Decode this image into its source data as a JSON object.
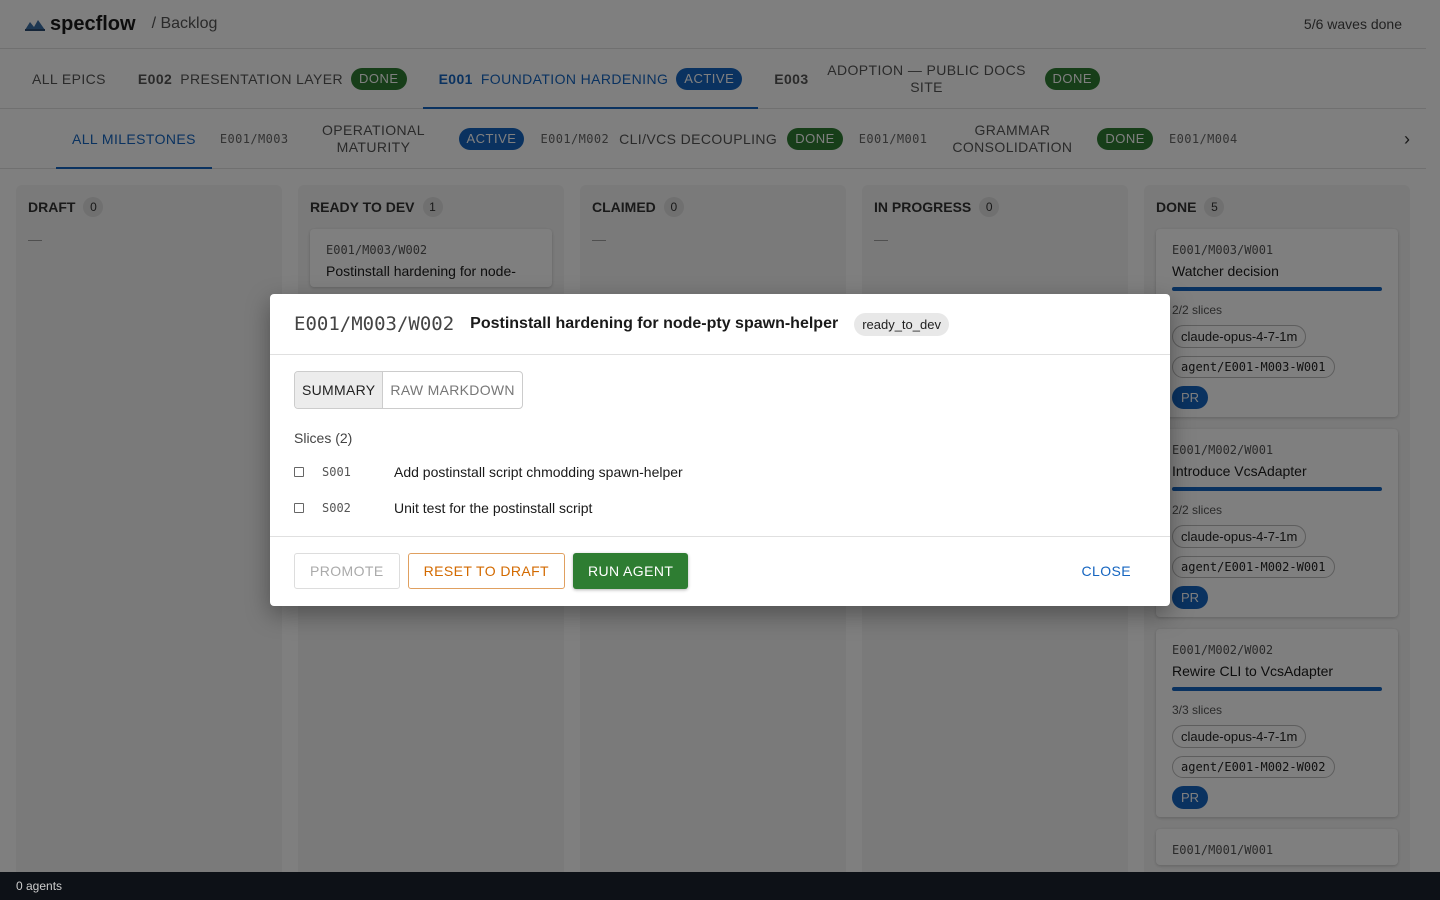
{
  "header": {
    "app_name": "specflow",
    "breadcrumb": "/ Backlog",
    "waves_status": "5/6 waves done"
  },
  "epic_tabs": {
    "all": "ALL EPICS",
    "items": [
      {
        "code": "E002",
        "name": "PRESENTATION LAYER",
        "status": "DONE"
      },
      {
        "code": "E001",
        "name": "FOUNDATION HARDENING",
        "status": "ACTIVE"
      },
      {
        "code": "E003",
        "name": "ADOPTION — PUBLIC DOCS SITE",
        "status": "DONE"
      }
    ]
  },
  "milestone_tabs": {
    "all": "ALL MILESTONES",
    "items": [
      {
        "code": "E001/M003",
        "name": "OPERATIONAL MATURITY",
        "status": "ACTIVE"
      },
      {
        "code": "E001/M002",
        "name": "CLI/VCS DECOUPLING",
        "status": "DONE"
      },
      {
        "code": "E001/M001",
        "name": "GRAMMAR CONSOLIDATION",
        "status": "DONE"
      },
      {
        "code": "E001/M004",
        "name": "",
        "status": ""
      }
    ],
    "scroll_icon": "chevron-right-icon"
  },
  "columns": [
    {
      "name": "DRAFT",
      "count": "0",
      "empty": "—"
    },
    {
      "name": "READY TO DEV",
      "count": "1"
    },
    {
      "name": "CLAIMED",
      "count": "0",
      "empty": "—"
    },
    {
      "name": "IN PROGRESS",
      "count": "0",
      "empty": "—"
    },
    {
      "name": "DONE",
      "count": "5"
    }
  ],
  "ready_card": {
    "id": "E001/M003/W002",
    "title": "Postinstall hardening for node-"
  },
  "done_cards": [
    {
      "id": "E001/M003/W001",
      "title": "Watcher decision",
      "slices": "2/2 slices",
      "model": "claude-opus-4-7-1m",
      "branch": "agent/E001-M003-W001",
      "pr": "PR"
    },
    {
      "id": "E001/M002/W001",
      "title": "Introduce VcsAdapter",
      "slices": "2/2 slices",
      "model": "claude-opus-4-7-1m",
      "branch": "agent/E001-M002-W001",
      "pr": "PR"
    },
    {
      "id": "E001/M002/W002",
      "title": "Rewire CLI to VcsAdapter",
      "slices": "3/3 slices",
      "model": "claude-opus-4-7-1m",
      "branch": "agent/E001-M002-W002",
      "pr": "PR"
    },
    {
      "id": "E001/M001/W001"
    }
  ],
  "dialog": {
    "id": "E001/M003/W002",
    "title": "Postinstall hardening for node-pty spawn-helper",
    "status": "ready_to_dev",
    "tabs": [
      "SUMMARY",
      "RAW MARKDOWN"
    ],
    "slices_label": "Slices (2)",
    "slices": [
      {
        "code": "S001",
        "text": "Add postinstall script chmodding spawn-helper"
      },
      {
        "code": "S002",
        "text": "Unit test for the postinstall script"
      }
    ],
    "buttons": {
      "promote": "PROMOTE",
      "reset": "RESET TO DRAFT",
      "run": "RUN AGENT",
      "close": "CLOSE"
    }
  },
  "statusbar": {
    "agents": "0 agents"
  },
  "colors": {
    "primary": "#1565c0",
    "success": "#2e7d32",
    "warning": "#d36a00"
  }
}
